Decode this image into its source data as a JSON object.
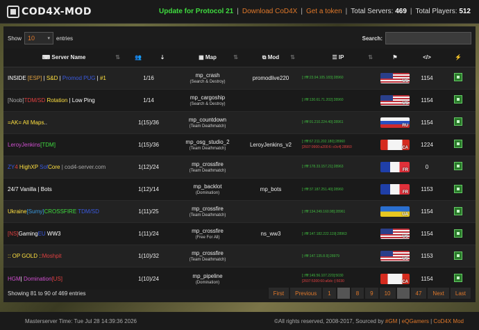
{
  "header": {
    "logo_text": "COD4X-MOD",
    "update": "Update for Protocol 21",
    "download": "Download CoD4X",
    "token": "Get a token",
    "servers_label": "Total Servers:",
    "servers_value": "469",
    "players_label": "Total Players:",
    "players_value": "512"
  },
  "controls": {
    "show_label": "Show",
    "entries_value": "10",
    "entries_label": "entries",
    "search_label": "Search:"
  },
  "columns": [
    "Server Name",
    "",
    "",
    "Map",
    "Mod",
    "IP",
    "",
    "",
    ""
  ],
  "rows": [
    {
      "name": [
        [
          "INSIDE ",
          "#fff"
        ],
        [
          "[ESP]",
          "#e0a040"
        ],
        [
          " | ",
          "#fff"
        ],
        [
          "S&D",
          "#ffe040"
        ],
        [
          " | ",
          "#fff"
        ],
        [
          "Promod PUG",
          "#3a5ae0"
        ],
        [
          " | ",
          "#fff"
        ],
        [
          "#1",
          "#ffe040"
        ]
      ],
      "players": "1/16",
      "map": "mp_crash",
      "mode": "(Search & Destroy)",
      "mod": "promodlive220",
      "ip1": "[::ffff:23.94.105.183]:28960",
      "ip2": "",
      "flag": "us",
      "cc": "US",
      "version": "1154"
    },
    {
      "name": [
        [
          "[Noob]",
          "#aaa"
        ],
        [
          "TDM/SD",
          "#e04040"
        ],
        [
          " Rotation",
          "#ffe040"
        ],
        [
          " | Low Ping",
          "#fff"
        ]
      ],
      "players": "1/14",
      "map": "mp_cargoship",
      "mode": "(Search & Destroy)",
      "mod": "",
      "ip1": "[::ffff:130.61.71.202]:28960",
      "ip2": "",
      "flag": "us",
      "cc": "US",
      "version": "1154"
    },
    {
      "name": [
        [
          "=AK= All Maps",
          "#ffe040"
        ],
        [
          "..",
          "#fff"
        ]
      ],
      "players": "1(15)/36",
      "map": "mp_countdown",
      "mode": "(Team Deathmatch)",
      "mod": "",
      "ip1": "[::ffff:91.210.224.40]:28961",
      "ip2": "",
      "flag": "ru",
      "cc": "RU",
      "version": "1154"
    },
    {
      "name": [
        [
          "LeroyJenkins",
          "#d050d0"
        ],
        [
          "[TDM]",
          "#3fdc3f"
        ]
      ],
      "players": "1(15)/36",
      "map": "mp_osg_studio_2",
      "mode": "(Team Deathmatch)",
      "mod": "LeroyJenkins_v2",
      "ip1": "[::ffff:67.211.202.180]:28960",
      "ip2": "[2607:9900:a200:6::c0c4]:28960",
      "flag": "ca",
      "cc": "CA",
      "version": "1224"
    },
    {
      "name": [
        [
          "ZY",
          "#3a5ae0"
        ],
        [
          "4",
          "#e04040"
        ],
        [
          " HighXP",
          "#ffe040"
        ],
        [
          " Sof",
          "#3a5ae0"
        ],
        [
          "Core",
          "#ffe040"
        ],
        [
          " | cod4-server.com",
          "#aaa"
        ]
      ],
      "players": "1(12)/24",
      "map": "mp_crossfire",
      "mode": "(Team Deathmatch)",
      "mod": "",
      "ip1": "[::ffff:178.33.157.21]:28963",
      "ip2": "",
      "flag": "fr",
      "cc": "FR",
      "version": "0"
    },
    {
      "name": [
        [
          "24/7 Vanilla | Bots",
          "#fff"
        ]
      ],
      "players": "1(12)/14",
      "map": "mp_backlot",
      "mode": "(Domination)",
      "mod": "mp_bots",
      "ip1": "[::ffff:37.187.251.40]:28960",
      "ip2": "",
      "flag": "fr",
      "cc": "FR",
      "version": "1153"
    },
    {
      "name": [
        [
          "Ukraine",
          "#ffe040"
        ],
        [
          "[Sumy]",
          "#3a9ae0"
        ],
        [
          "CROSSFIRE",
          "#3fdc3f"
        ],
        [
          " TDM/SD",
          "#3a5ae0"
        ]
      ],
      "players": "1(11)/25",
      "map": "mp_crossfire",
      "mode": "(Team Deathmatch)",
      "mod": "",
      "ip1": "[::ffff:134.249.160.98]:28961",
      "ip2": "",
      "flag": "ua",
      "cc": "UA",
      "version": "1154"
    },
    {
      "name": [
        [
          "[NS]",
          "#e04040"
        ],
        [
          "Gaming",
          "#fff"
        ],
        [
          "EU",
          "#3a5ae0"
        ],
        [
          " WW3",
          "#fff"
        ]
      ],
      "players": "1(11)/24",
      "map": "mp_crossfire",
      "mode": "(Free For All)",
      "mod": "ns_ww3",
      "ip1": "[::ffff:147.182.222.119]:28963",
      "ip2": "",
      "flag": "us",
      "cc": "US",
      "version": "1154"
    },
    {
      "name": [
        [
          ":: OP GOLD :",
          "#ffe040"
        ],
        [
          ":Moshpit",
          "#e04040"
        ]
      ],
      "players": "1(10)/32",
      "map": "mp_crossfire",
      "mode": "(Team Deathmatch)",
      "mod": "",
      "ip1": "[::ffff:147.135.8.9]:28979",
      "ip2": "",
      "flag": "us",
      "cc": "US",
      "version": "1153"
    },
    {
      "name": [
        [
          "HGM",
          "#d050d0"
        ],
        [
          "| ",
          "#fff"
        ],
        [
          "Domination",
          "#d050d0"
        ],
        [
          "[US]",
          "#e04040"
        ]
      ],
      "players": "1(10)/24",
      "map": "mp_pipeline",
      "mode": "(Domination)",
      "mod": "",
      "ip1": "[::ffff:149.56.107.220]:5030",
      "ip2": "[2607:5300:60:a6dc::]:5030",
      "flag": "ca",
      "cc": "CA",
      "version": "1154"
    }
  ],
  "footer": {
    "info": "Showing 81 to 90 of 469 entries",
    "pager": [
      "First",
      "Previous",
      "1",
      "…",
      "8",
      "9",
      "10",
      "…",
      "47",
      "Next",
      "Last"
    ]
  },
  "site_footer": {
    "time": "Masterserver Time: Tue Jul 28 14:39:36 2026",
    "copyright": "©All rights reserved, 2008-2017, Sourced by",
    "links": [
      "#GM",
      "eQGamers",
      "CoD4X Mod"
    ]
  },
  "colors": {
    "accent": "#e0782a",
    "update": "#3fdc3f",
    "ip": "#3fb83f",
    "ip_v6": "#e04040"
  }
}
